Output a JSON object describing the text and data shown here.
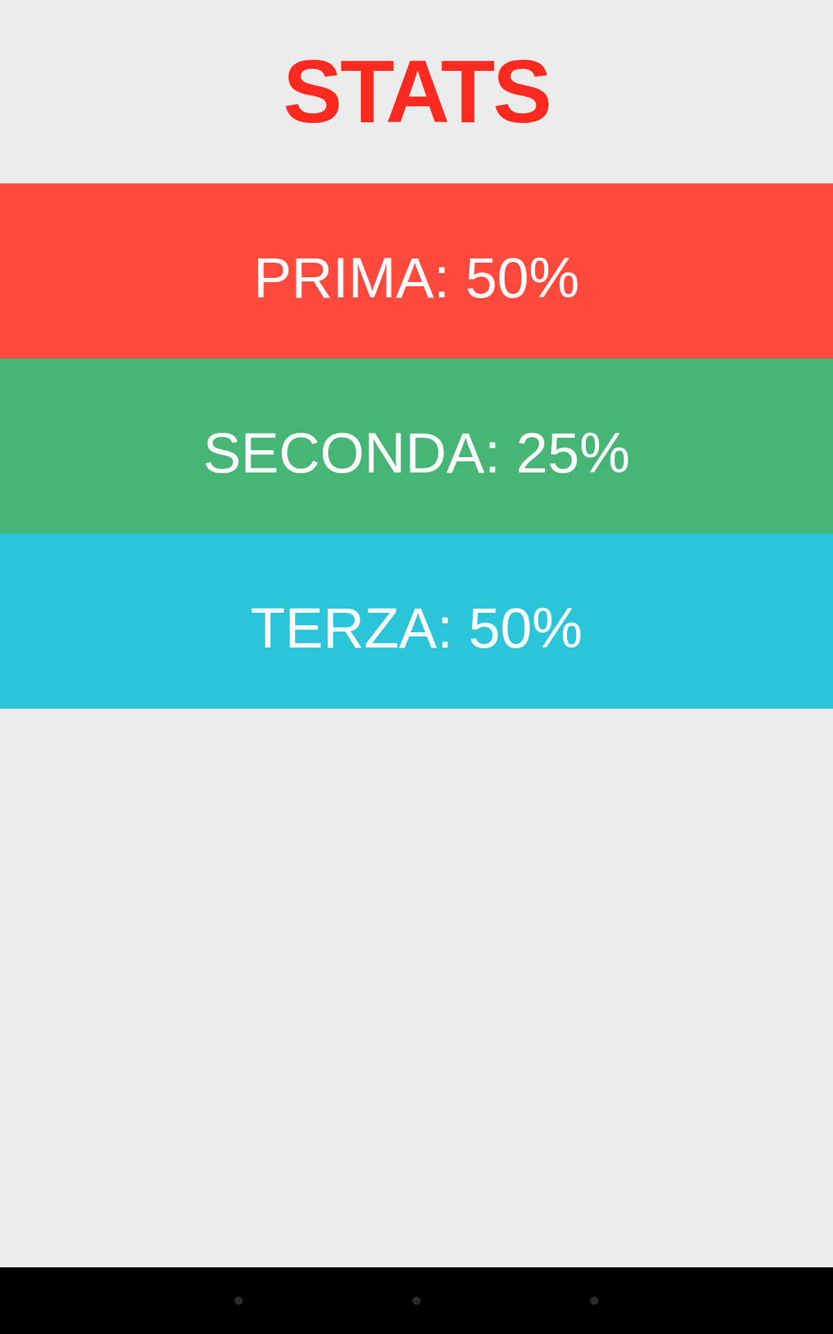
{
  "title": "STATS",
  "stats": [
    {
      "label": "PRIMA: 50%",
      "color": "#ff4a3d"
    },
    {
      "label": "SECONDA: 25%",
      "color": "#47b576"
    },
    {
      "label": "TERZA: 50%",
      "color": "#2bc4d8"
    }
  ]
}
